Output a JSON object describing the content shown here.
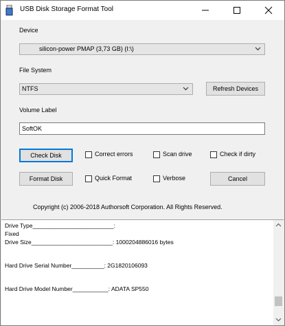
{
  "window": {
    "title": "USB Disk Storage Format Tool"
  },
  "device": {
    "label": "Device",
    "selected": "silicon-power  PMAP (3,73 GB) (I:\\)"
  },
  "file_system": {
    "label": "File System",
    "selected": "NTFS"
  },
  "buttons": {
    "refresh": "Refresh Devices",
    "check_disk": "Check Disk",
    "format_disk": "Format Disk",
    "cancel": "Cancel"
  },
  "volume": {
    "label": "Volume Label",
    "value": "SoftOK"
  },
  "options": {
    "correct_errors": {
      "label": "Correct errors",
      "checked": false
    },
    "scan_drive": {
      "label": "Scan drive",
      "checked": false
    },
    "check_if_dirty": {
      "label": "Check if dirty",
      "checked": false
    },
    "quick_format": {
      "label": "Quick Format",
      "checked": false
    },
    "verbose": {
      "label": "Verbose",
      "checked": false
    }
  },
  "copyright": "Copyright (c) 2006-2018 Authorsoft Corporation. All Rights Reserved.",
  "info_lines": [
    "Drive Type_________________________:",
    "Fixed",
    "Drive Size_________________________: 1000204886016 bytes",
    "Hard Drive Serial Number__________: 2G1820106093",
    "Hard Drive Model Number___________: ADATA SP550"
  ]
}
